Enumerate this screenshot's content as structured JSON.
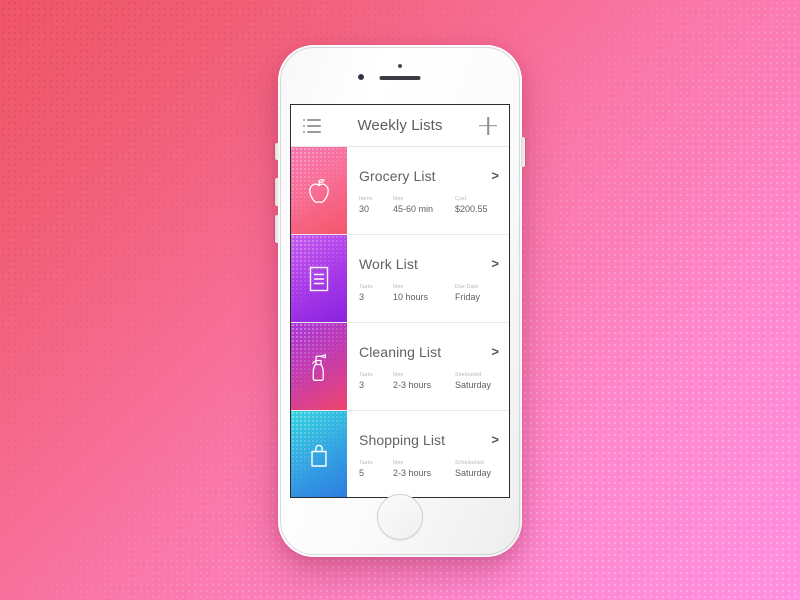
{
  "background": {
    "gradient_start": "#EF5566",
    "gradient_end": "#FF8FE0"
  },
  "device": {
    "name": "white-smartphone",
    "body_color": "#FFFFFF"
  },
  "app": {
    "header": {
      "menu_icon": "list-menu-icon",
      "title": "Weekly Lists",
      "add_icon": "plus-icon"
    },
    "cards": [
      {
        "icon": "apple-icon",
        "title": "Grocery List",
        "chevron": ">",
        "gradient_start": "#F975B0",
        "gradient_end": "#F4566A",
        "stats": [
          {
            "label": "Items",
            "value": "30"
          },
          {
            "label": "time",
            "value": "45-60 min"
          },
          {
            "label": "Cost",
            "value": "$200.55"
          }
        ]
      },
      {
        "icon": "document-icon",
        "title": "Work List",
        "chevron": ">",
        "gradient_start": "#C45BF0",
        "gradient_end": "#8A23E0",
        "stats": [
          {
            "label": "Tasks",
            "value": "3"
          },
          {
            "label": "time",
            "value": "10 hours"
          },
          {
            "label": "Due Date",
            "value": "Friday"
          }
        ]
      },
      {
        "icon": "spray-bottle-icon",
        "title": "Cleaning List",
        "chevron": ">",
        "gradient_start": "#A736D8",
        "gradient_end": "#F0456E",
        "stats": [
          {
            "label": "Tasks",
            "value": "3"
          },
          {
            "label": "time",
            "value": "2-3 hours"
          },
          {
            "label": "Shedueled",
            "value": "Saturday"
          }
        ]
      },
      {
        "icon": "shopping-bag-icon",
        "title": "Shopping List",
        "chevron": ">",
        "gradient_start": "#35D3DF",
        "gradient_end": "#2E7BE0",
        "stats": [
          {
            "label": "Tasks",
            "value": "5"
          },
          {
            "label": "time",
            "value": "2-3 hours"
          },
          {
            "label": "Schedueled",
            "value": "Saturday"
          }
        ]
      }
    ]
  }
}
